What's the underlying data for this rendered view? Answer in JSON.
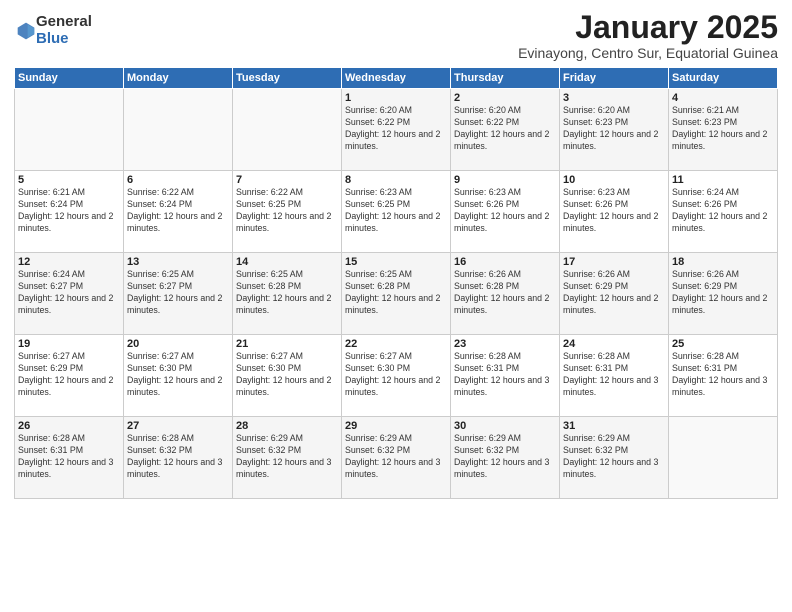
{
  "logo": {
    "general": "General",
    "blue": "Blue"
  },
  "header": {
    "month": "January 2025",
    "location": "Evinayong, Centro Sur, Equatorial Guinea"
  },
  "days_of_week": [
    "Sunday",
    "Monday",
    "Tuesday",
    "Wednesday",
    "Thursday",
    "Friday",
    "Saturday"
  ],
  "weeks": [
    [
      {
        "day": "",
        "info": ""
      },
      {
        "day": "",
        "info": ""
      },
      {
        "day": "",
        "info": ""
      },
      {
        "day": "1",
        "info": "Sunrise: 6:20 AM\nSunset: 6:22 PM\nDaylight: 12 hours and 2 minutes."
      },
      {
        "day": "2",
        "info": "Sunrise: 6:20 AM\nSunset: 6:22 PM\nDaylight: 12 hours and 2 minutes."
      },
      {
        "day": "3",
        "info": "Sunrise: 6:20 AM\nSunset: 6:23 PM\nDaylight: 12 hours and 2 minutes."
      },
      {
        "day": "4",
        "info": "Sunrise: 6:21 AM\nSunset: 6:23 PM\nDaylight: 12 hours and 2 minutes."
      }
    ],
    [
      {
        "day": "5",
        "info": "Sunrise: 6:21 AM\nSunset: 6:24 PM\nDaylight: 12 hours and 2 minutes."
      },
      {
        "day": "6",
        "info": "Sunrise: 6:22 AM\nSunset: 6:24 PM\nDaylight: 12 hours and 2 minutes."
      },
      {
        "day": "7",
        "info": "Sunrise: 6:22 AM\nSunset: 6:25 PM\nDaylight: 12 hours and 2 minutes."
      },
      {
        "day": "8",
        "info": "Sunrise: 6:23 AM\nSunset: 6:25 PM\nDaylight: 12 hours and 2 minutes."
      },
      {
        "day": "9",
        "info": "Sunrise: 6:23 AM\nSunset: 6:26 PM\nDaylight: 12 hours and 2 minutes."
      },
      {
        "day": "10",
        "info": "Sunrise: 6:23 AM\nSunset: 6:26 PM\nDaylight: 12 hours and 2 minutes."
      },
      {
        "day": "11",
        "info": "Sunrise: 6:24 AM\nSunset: 6:26 PM\nDaylight: 12 hours and 2 minutes."
      }
    ],
    [
      {
        "day": "12",
        "info": "Sunrise: 6:24 AM\nSunset: 6:27 PM\nDaylight: 12 hours and 2 minutes."
      },
      {
        "day": "13",
        "info": "Sunrise: 6:25 AM\nSunset: 6:27 PM\nDaylight: 12 hours and 2 minutes."
      },
      {
        "day": "14",
        "info": "Sunrise: 6:25 AM\nSunset: 6:28 PM\nDaylight: 12 hours and 2 minutes."
      },
      {
        "day": "15",
        "info": "Sunrise: 6:25 AM\nSunset: 6:28 PM\nDaylight: 12 hours and 2 minutes."
      },
      {
        "day": "16",
        "info": "Sunrise: 6:26 AM\nSunset: 6:28 PM\nDaylight: 12 hours and 2 minutes."
      },
      {
        "day": "17",
        "info": "Sunrise: 6:26 AM\nSunset: 6:29 PM\nDaylight: 12 hours and 2 minutes."
      },
      {
        "day": "18",
        "info": "Sunrise: 6:26 AM\nSunset: 6:29 PM\nDaylight: 12 hours and 2 minutes."
      }
    ],
    [
      {
        "day": "19",
        "info": "Sunrise: 6:27 AM\nSunset: 6:29 PM\nDaylight: 12 hours and 2 minutes."
      },
      {
        "day": "20",
        "info": "Sunrise: 6:27 AM\nSunset: 6:30 PM\nDaylight: 12 hours and 2 minutes."
      },
      {
        "day": "21",
        "info": "Sunrise: 6:27 AM\nSunset: 6:30 PM\nDaylight: 12 hours and 2 minutes."
      },
      {
        "day": "22",
        "info": "Sunrise: 6:27 AM\nSunset: 6:30 PM\nDaylight: 12 hours and 2 minutes."
      },
      {
        "day": "23",
        "info": "Sunrise: 6:28 AM\nSunset: 6:31 PM\nDaylight: 12 hours and 3 minutes."
      },
      {
        "day": "24",
        "info": "Sunrise: 6:28 AM\nSunset: 6:31 PM\nDaylight: 12 hours and 3 minutes."
      },
      {
        "day": "25",
        "info": "Sunrise: 6:28 AM\nSunset: 6:31 PM\nDaylight: 12 hours and 3 minutes."
      }
    ],
    [
      {
        "day": "26",
        "info": "Sunrise: 6:28 AM\nSunset: 6:31 PM\nDaylight: 12 hours and 3 minutes."
      },
      {
        "day": "27",
        "info": "Sunrise: 6:28 AM\nSunset: 6:32 PM\nDaylight: 12 hours and 3 minutes."
      },
      {
        "day": "28",
        "info": "Sunrise: 6:29 AM\nSunset: 6:32 PM\nDaylight: 12 hours and 3 minutes."
      },
      {
        "day": "29",
        "info": "Sunrise: 6:29 AM\nSunset: 6:32 PM\nDaylight: 12 hours and 3 minutes."
      },
      {
        "day": "30",
        "info": "Sunrise: 6:29 AM\nSunset: 6:32 PM\nDaylight: 12 hours and 3 minutes."
      },
      {
        "day": "31",
        "info": "Sunrise: 6:29 AM\nSunset: 6:32 PM\nDaylight: 12 hours and 3 minutes."
      },
      {
        "day": "",
        "info": ""
      }
    ]
  ]
}
